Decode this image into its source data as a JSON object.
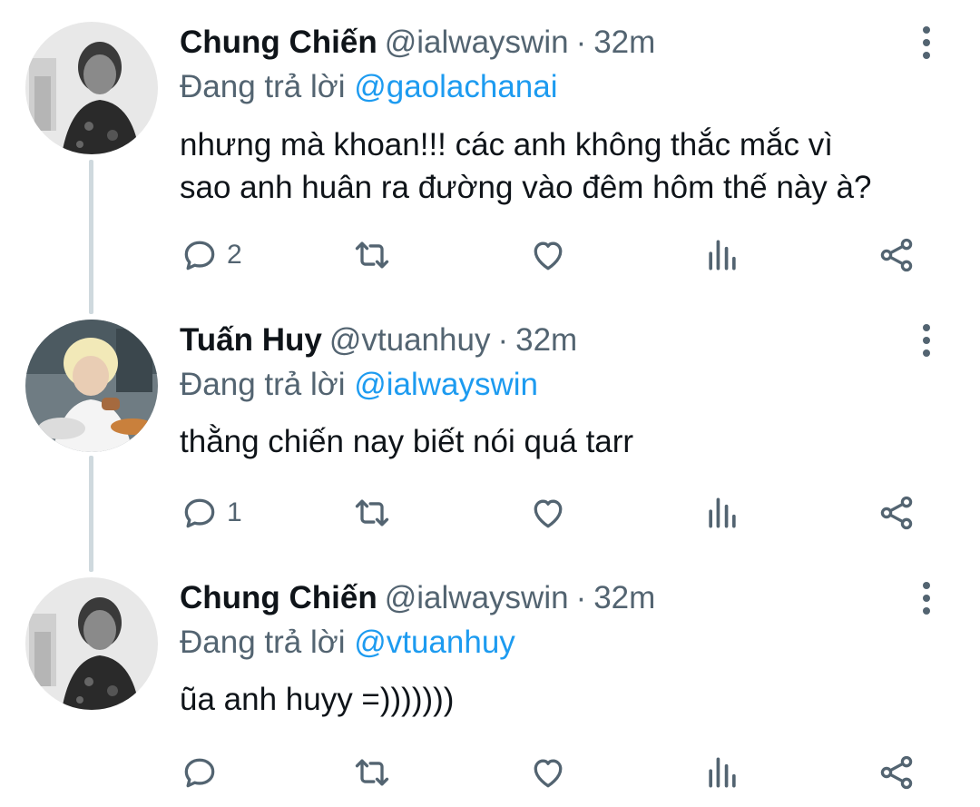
{
  "tweets": [
    {
      "name": "Chung Chiến",
      "handle": "@ialwayswin",
      "separator": "·",
      "time": "32m",
      "reply_prefix": "Đang trả lời",
      "reply_to": "@gaolachanai",
      "text_lines": [
        "nhưng mà khoan!!! các anh không thắc mắc vì",
        "sao anh huân ra đường vào đêm hôm thế này à?"
      ],
      "reply_count": "2"
    },
    {
      "name": "Tuấn Huy",
      "handle": "@vtuanhuy",
      "separator": "·",
      "time": "32m",
      "reply_prefix": "Đang trả lời",
      "reply_to": "@ialwayswin",
      "text_lines": [
        "thằng chiến nay biết nói quá tarr"
      ],
      "reply_count": "1"
    },
    {
      "name": "Chung Chiến",
      "handle": "@ialwayswin",
      "separator": "·",
      "time": "32m",
      "reply_prefix": "Đang trả lời",
      "reply_to": "@vtuanhuy",
      "text_lines": [
        "ũa anh huyy =)))))))"
      ],
      "reply_count": ""
    }
  ],
  "icons": [
    "reply-icon",
    "retweet-icon",
    "like-icon",
    "analytics-icon",
    "share-icon",
    "more-icon"
  ],
  "colors": {
    "text": "#0f1419",
    "secondary": "#536471",
    "link": "#1d9bf0",
    "thread_line": "#cfd9de"
  }
}
